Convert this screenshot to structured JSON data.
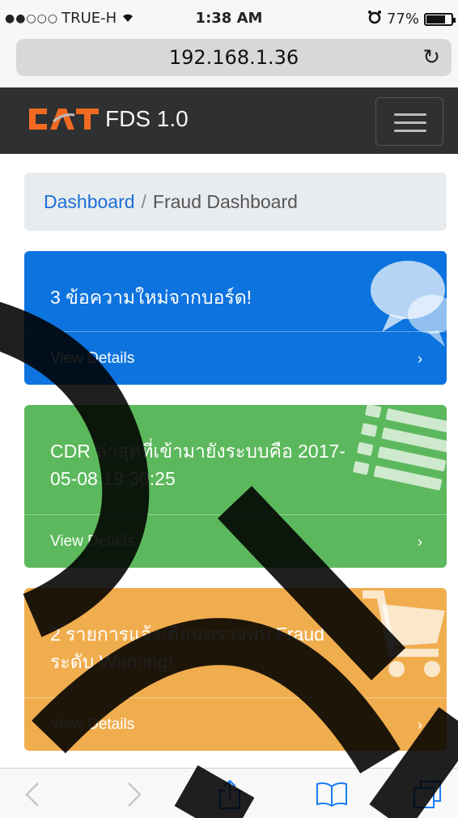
{
  "status_bar": {
    "carrier": "TRUE-H",
    "time": "1:38 AM",
    "battery_text": "77%",
    "battery_level": 0.77
  },
  "address_bar": {
    "url": "192.168.1.36"
  },
  "navbar": {
    "brand_logo_text": "CAT",
    "brand_text": "FDS 1.0"
  },
  "breadcrumb": {
    "link": "Dashboard",
    "separator": "/",
    "active": "Fraud Dashboard"
  },
  "cards": [
    {
      "text": "3 ข้อความใหม่จากบอร์ด!",
      "footer": "View Details",
      "icon": "comments-icon",
      "color": "#0d73de"
    },
    {
      "text": "CDR ล่าสุดที่เข้ามายังระบบคือ 2017-05-08 19:30:25",
      "footer": "View Details",
      "icon": "list-icon",
      "color": "#5cb85c"
    },
    {
      "text": "2 รายการแจ้งเตือนตรวจพบ Fraud ระดับ Warning!",
      "footer": "View Details",
      "icon": "shopping-cart-icon",
      "color": "#f0ad4e"
    }
  ],
  "colors": {
    "navbar_bg": "#2f3031",
    "logo_orange": "#f26a21",
    "link_blue": "#1a6fd8",
    "toolbar_blue": "#1a7cf4"
  }
}
